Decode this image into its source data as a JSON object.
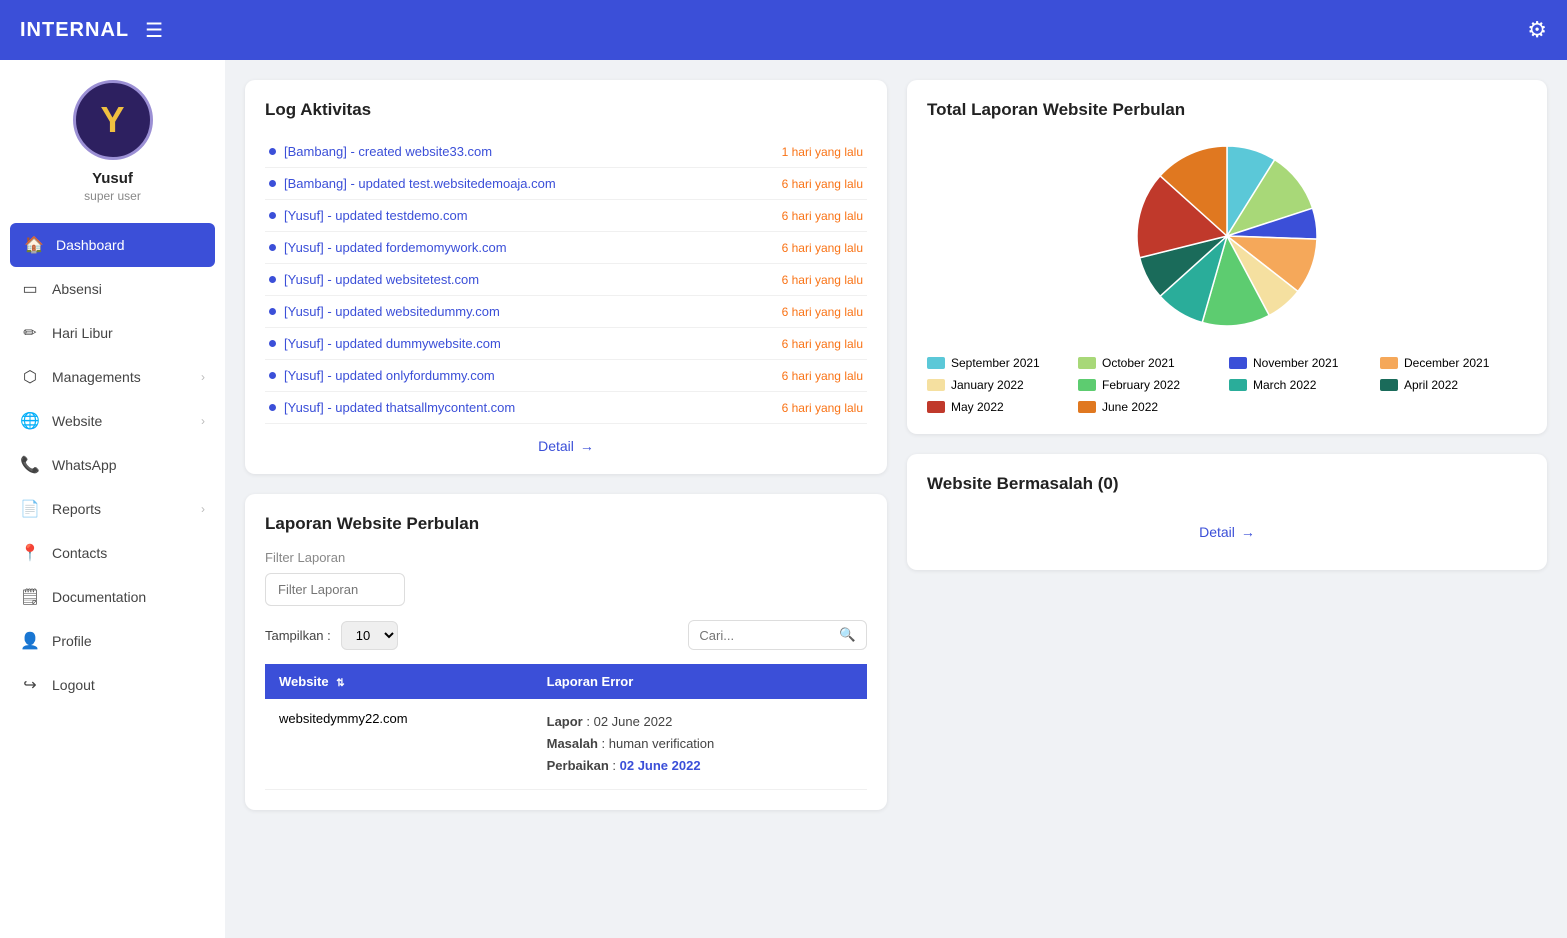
{
  "app": {
    "title": "INTERNAL",
    "settings_icon": "⚙"
  },
  "sidebar": {
    "user": {
      "name": "Yusuf",
      "role": "super user",
      "avatar_letter": "Y"
    },
    "nav_items": [
      {
        "id": "dashboard",
        "label": "Dashboard",
        "icon": "🏠",
        "active": true,
        "has_arrow": false
      },
      {
        "id": "absensi",
        "label": "Absensi",
        "icon": "📋",
        "active": false,
        "has_arrow": false
      },
      {
        "id": "hari-libur",
        "label": "Hari Libur",
        "icon": "✏",
        "active": false,
        "has_arrow": false
      },
      {
        "id": "managements",
        "label": "Managements",
        "icon": "📦",
        "active": false,
        "has_arrow": true
      },
      {
        "id": "website",
        "label": "Website",
        "icon": "🌐",
        "active": false,
        "has_arrow": true
      },
      {
        "id": "whatsapp",
        "label": "WhatsApp",
        "icon": "📞",
        "active": false,
        "has_arrow": false
      },
      {
        "id": "reports",
        "label": "Reports",
        "icon": "📄",
        "active": false,
        "has_arrow": true
      },
      {
        "id": "contacts",
        "label": "Contacts",
        "icon": "📍",
        "active": false,
        "has_arrow": false
      },
      {
        "id": "documentation",
        "label": "Documentation",
        "icon": "📋",
        "active": false,
        "has_arrow": false
      },
      {
        "id": "profile",
        "label": "Profile",
        "icon": "👤",
        "active": false,
        "has_arrow": false
      },
      {
        "id": "logout",
        "label": "Logout",
        "icon": "➡",
        "active": false,
        "has_arrow": false
      }
    ]
  },
  "log_aktivitas": {
    "title": "Log Aktivitas",
    "detail_label": "Detail",
    "items": [
      {
        "text": "[Bambang] - created website33.com",
        "time": "1 hari yang lalu"
      },
      {
        "text": "[Bambang] - updated test.websitedemoaja.com",
        "time": "6 hari yang lalu"
      },
      {
        "text": "[Yusuf] - updated testdemo.com",
        "time": "6 hari yang lalu"
      },
      {
        "text": "[Yusuf] - updated fordemomywork.com",
        "time": "6 hari yang lalu"
      },
      {
        "text": "[Yusuf] - updated websitetest.com",
        "time": "6 hari yang lalu"
      },
      {
        "text": "[Yusuf] - updated websitedummy.com",
        "time": "6 hari yang lalu"
      },
      {
        "text": "[Yusuf] - updated dummywebsite.com",
        "time": "6 hari yang lalu"
      },
      {
        "text": "[Yusuf] - updated onlyfordummy.com",
        "time": "6 hari yang lalu"
      },
      {
        "text": "[Yusuf] - updated thatsallmycontent.com",
        "time": "6 hari yang lalu"
      }
    ]
  },
  "laporan": {
    "title": "Laporan Website Perbulan",
    "filter_label": "Filter Laporan",
    "filter_placeholder": "Filter Laporan",
    "tampilkan_label": "Tampilkan :",
    "tampilkan_value": "10",
    "search_placeholder": "Cari...",
    "table": {
      "col_website": "Website",
      "col_laporan": "Laporan Error",
      "rows": [
        {
          "website": "websitedymmy22.com",
          "lapor_date": "02 June 2022",
          "masalah": "human verification",
          "perbaikan_date": "02 June 2022"
        }
      ]
    }
  },
  "pie_chart": {
    "title": "Total Laporan Website Perbulan",
    "segments": [
      {
        "label": "September 2021",
        "color": "#5bc8d8",
        "value": 8
      },
      {
        "label": "October 2021",
        "color": "#a8d878",
        "value": 10
      },
      {
        "label": "November 2021",
        "color": "#3b4fd8",
        "value": 5
      },
      {
        "label": "December 2021",
        "color": "#f5a85a",
        "value": 9
      },
      {
        "label": "January 2022",
        "color": "#f5e0a0",
        "value": 6
      },
      {
        "label": "February 2022",
        "color": "#5dcc70",
        "value": 11
      },
      {
        "label": "March 2022",
        "color": "#2aad9a",
        "value": 8
      },
      {
        "label": "April 2022",
        "color": "#1a6b5a",
        "value": 7
      },
      {
        "label": "May 2022",
        "color": "#c0392b",
        "value": 14
      },
      {
        "label": "June 2022",
        "color": "#e07820",
        "value": 12
      }
    ]
  },
  "website_bermasalah": {
    "title": "Website Bermasalah (0)",
    "detail_label": "Detail"
  }
}
